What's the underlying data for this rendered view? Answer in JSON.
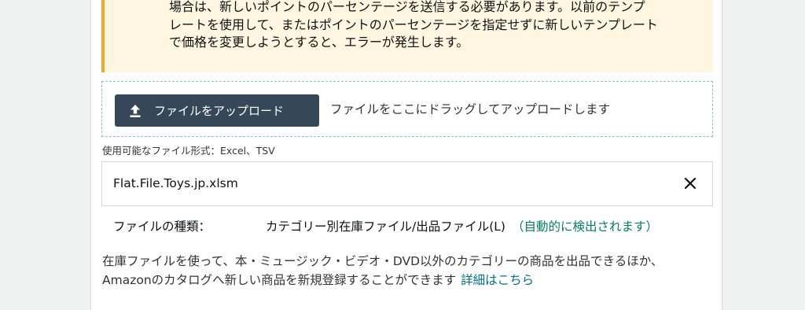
{
  "alert": {
    "lines": [
      "場合は、新しいポイントのパーセンテージを送信する必要があります。以前のテンプ",
      "レートを使用して、またはポイントのパーセンテージを指定せずに新しいテンプレート",
      "で価格を変更しようとすると、エラーが発生します。"
    ]
  },
  "upload": {
    "button_label": "ファイルをアップロード",
    "icon": "upload-icon",
    "drop_hint": "ファイルをここにドラッグしてアップロードします",
    "formats": "使用可能なファイル形式：Excel、TSV"
  },
  "file": {
    "name": "Flat.File.Toys.jp.xlsm",
    "remove_icon": "close-icon"
  },
  "file_type": {
    "label": "ファイルの種類：",
    "value": "カテゴリー別在庫ファイル/出品ファイル(L)",
    "auto_detected": "（自動的に検出されます）"
  },
  "description": {
    "text": "在庫ファイルを使って、本・ミュージック・ビデオ・DVD以外のカテゴリーの商品を出品できるほか、Amazonのカタログへ新しい商品を新規登録することができます",
    "link": "詳細はこちら"
  },
  "colors": {
    "alert_bg": "#fef6e0",
    "alert_accent": "#f5a623",
    "button_bg": "#37475a",
    "success_green": "#067d62",
    "link": "#007185"
  }
}
